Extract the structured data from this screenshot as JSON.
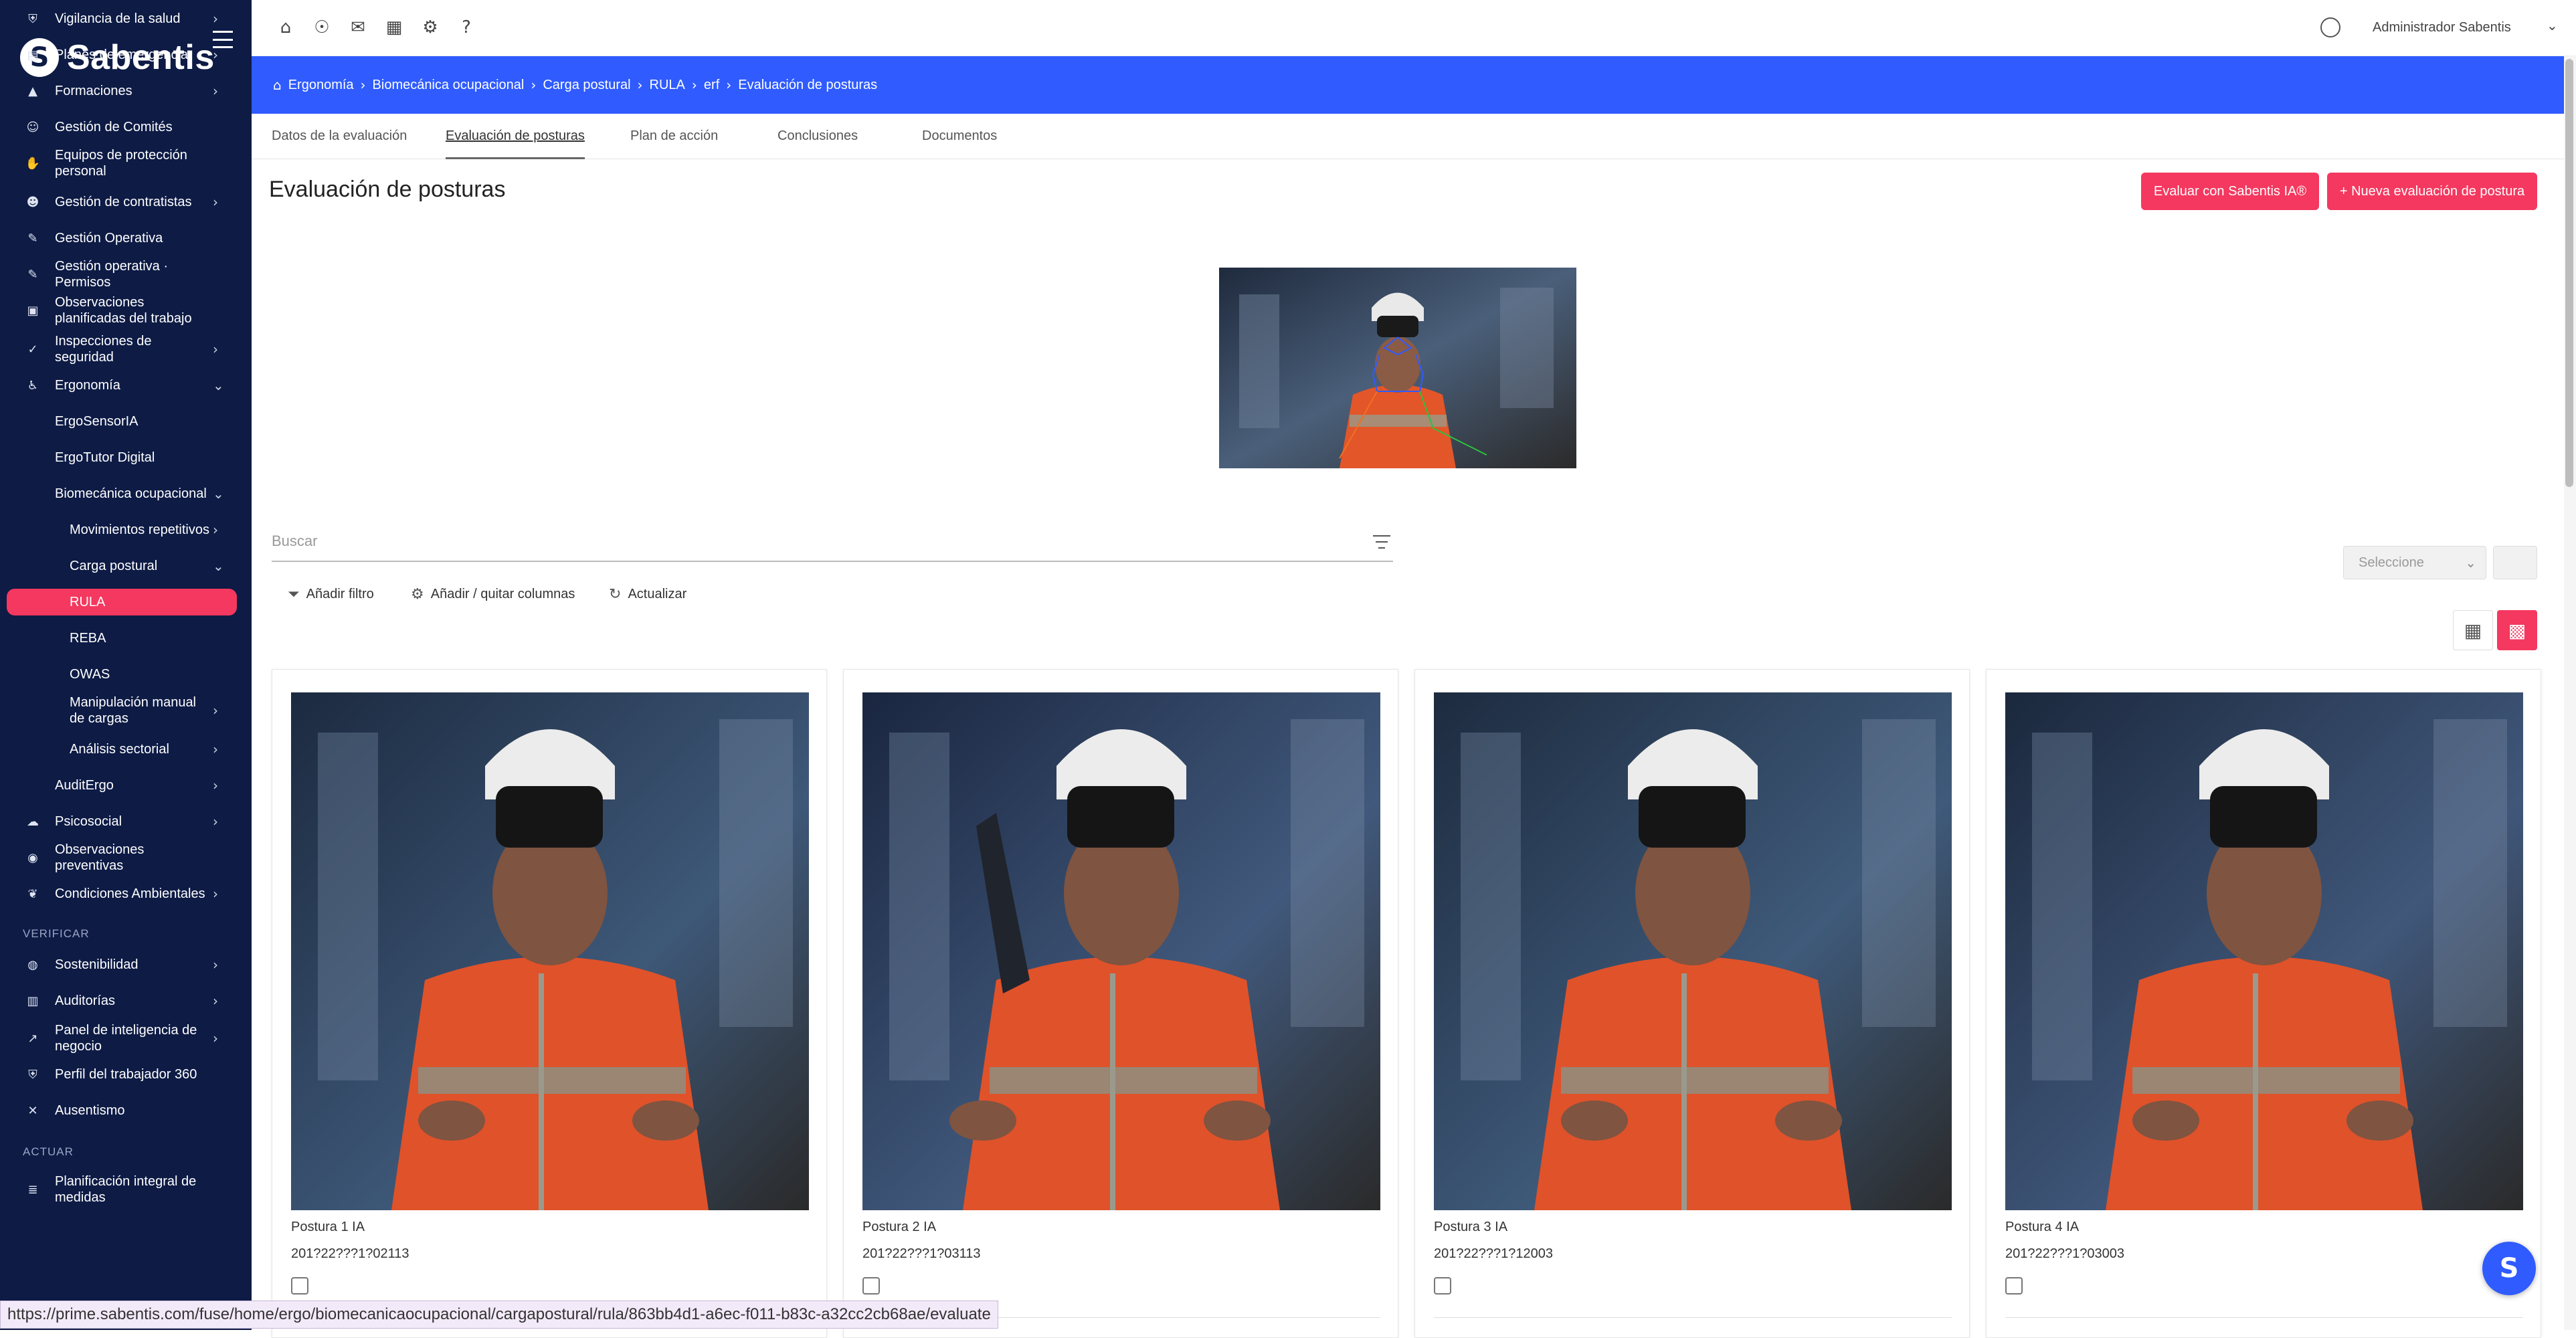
{
  "app": {
    "name": "Sabentis",
    "logo_letter": "S"
  },
  "sidebar": {
    "items": [
      {
        "label": "Vigilancia de la salud",
        "icon": "shield-icon",
        "chevron": true
      },
      {
        "label": "Planes de emergencia",
        "icon": "building-icon",
        "chevron": true
      },
      {
        "label": "Formaciones",
        "icon": "graduation-cap-icon",
        "chevron": true
      },
      {
        "label": "Gestión de Comités",
        "icon": "users-icon",
        "chevron": false
      },
      {
        "label": "Equipos de protección personal",
        "icon": "handshake-icon",
        "chevron": false
      },
      {
        "label": "Gestión de contratistas",
        "icon": "team-icon",
        "chevron": true
      },
      {
        "label": "Gestión Operativa",
        "icon": "tools-icon",
        "chevron": false
      },
      {
        "label": "Gestión operativa · Permisos",
        "icon": "tools-icon",
        "chevron": false
      },
      {
        "label": "Observaciones planificadas del trabajo",
        "icon": "clipboard-icon",
        "chevron": false
      },
      {
        "label": "Inspecciones de seguridad",
        "icon": "check-icon",
        "chevron": true
      },
      {
        "label": "Ergonomía",
        "icon": "posture-icon",
        "chevron": true,
        "expanded": true
      },
      {
        "label": "ErgoSensorIA",
        "level": 1
      },
      {
        "label": "ErgoTutor Digital",
        "level": 1
      },
      {
        "label": "Biomecánica ocupacional",
        "level": 1,
        "chevron": true,
        "expanded": true
      },
      {
        "label": "Movimientos repetitivos",
        "level": 2,
        "chevron": true
      },
      {
        "label": "Carga postural",
        "level": 2,
        "chevron": true,
        "expanded": true
      },
      {
        "label": "RULA",
        "level": 2,
        "active": true
      },
      {
        "label": "REBA",
        "level": 2
      },
      {
        "label": "OWAS",
        "level": 2
      },
      {
        "label": "Manipulación manual de cargas",
        "level": 2,
        "chevron": true
      },
      {
        "label": "Análisis sectorial",
        "level": 2,
        "chevron": true
      },
      {
        "label": "AuditErgo",
        "level": 1,
        "chevron": true
      },
      {
        "label": "Psicosocial",
        "icon": "brain-icon",
        "chevron": true
      },
      {
        "label": "Observaciones preventivas",
        "icon": "eye-icon",
        "chevron": false
      },
      {
        "label": "Condiciones Ambientales",
        "icon": "leaf-icon",
        "chevron": true
      }
    ],
    "section_verificar": "VERIFICAR",
    "items_verificar": [
      {
        "label": "Sostenibilidad",
        "icon": "globe-icon",
        "chevron": true
      },
      {
        "label": "Auditorías",
        "icon": "audit-icon",
        "chevron": true
      },
      {
        "label": "Panel de inteligencia de negocio",
        "icon": "chart-icon",
        "chevron": true
      },
      {
        "label": "Perfil del trabajador 360",
        "icon": "shield-icon",
        "chevron": false
      },
      {
        "label": "Ausentismo",
        "icon": "user-x-icon",
        "chevron": false
      }
    ],
    "section_actuar": "ACTUAR",
    "items_actuar": [
      {
        "label": "Planificación integral de medidas",
        "icon": "plan-icon",
        "chevron": false
      }
    ]
  },
  "topbar": {
    "icons": [
      "home-icon",
      "award-icon",
      "mail-icon",
      "calendar-icon",
      "settings-icon",
      "help-icon"
    ],
    "user_name": "Administrador Sabentis"
  },
  "breadcrumb": [
    "Ergonomía",
    "Biomecánica ocupacional",
    "Carga postural",
    "RULA",
    "erf",
    "Evaluación de posturas"
  ],
  "tabs": [
    {
      "label": "Datos de la evaluación",
      "active": false
    },
    {
      "label": "Evaluación de posturas",
      "active": true
    },
    {
      "label": "Plan de acción",
      "active": false
    },
    {
      "label": "Conclusiones",
      "active": false
    },
    {
      "label": "Documentos",
      "active": false
    }
  ],
  "page": {
    "title": "Evaluación de posturas",
    "btn_ai": "Evaluar con Sabentis IA®",
    "btn_new": "+ Nueva evaluación de postura"
  },
  "search": {
    "placeholder": "Buscar"
  },
  "toolbar": {
    "add_filter": "Añadir filtro",
    "columns": "Añadir / quitar columnas",
    "refresh": "Actualizar",
    "select_placeholder": "Seleccione"
  },
  "cards": [
    {
      "title": "Postura 1 IA",
      "code": "201?22???1?02113"
    },
    {
      "title": "Postura 2 IA",
      "code": "201?22???1?03113"
    },
    {
      "title": "Postura 3 IA",
      "code": "201?22???1?12003"
    },
    {
      "title": "Postura 4 IA",
      "code": "201?22???1?03003"
    }
  ],
  "status_url": "https://prime.sabentis.com/fuse/home/ergo/biomecanicaocupacional/cargapostural/rula/863bb4d1-a6ec-f011-b83c-a32cc2cb68ae/evaluate",
  "colors": {
    "sidebar": "#0d1b45",
    "accent": "#f4385f",
    "breadcrumb": "#2f5bff"
  }
}
